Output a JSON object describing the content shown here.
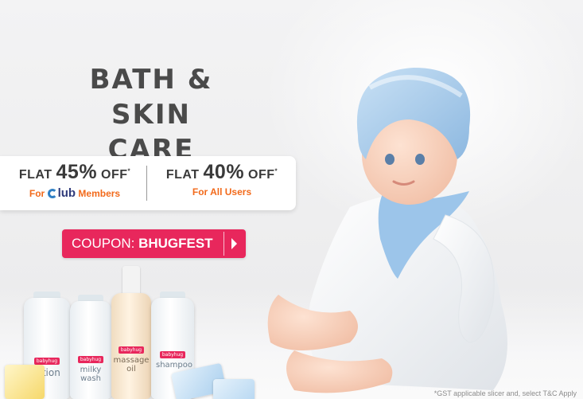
{
  "banner": {
    "title_line1": "BATH & SKIN",
    "title_line2": "CARE RANGE",
    "offers": {
      "club": {
        "prefix": "FLAT ",
        "percent": "45%",
        "suffix": " OFF",
        "asterisk": "*",
        "sub_prefix": "For ",
        "club_brand": "lub",
        "sub_suffix": " Members"
      },
      "all": {
        "prefix": "FLAT ",
        "percent": "40%",
        "suffix": " OFF",
        "asterisk": "*",
        "sub": "For All Users"
      }
    },
    "coupon": {
      "label": "COUPON: ",
      "code": "BHUGFEST"
    },
    "products": [
      {
        "brand": "babyhug",
        "name": "lotion"
      },
      {
        "brand": "babyhug",
        "name": "milky wash"
      },
      {
        "brand": "babyhug",
        "name": "massage oil"
      },
      {
        "brand": "babyhug",
        "name": "shampoo"
      }
    ],
    "footnote": "*GST applicable slicer and, select T&C Apply"
  },
  "colors": {
    "accent_pink": "#e8275c",
    "offer_orange": "#f26a1b",
    "title_gray": "#4a4a4a",
    "club_blue": "#2f7fc4"
  }
}
